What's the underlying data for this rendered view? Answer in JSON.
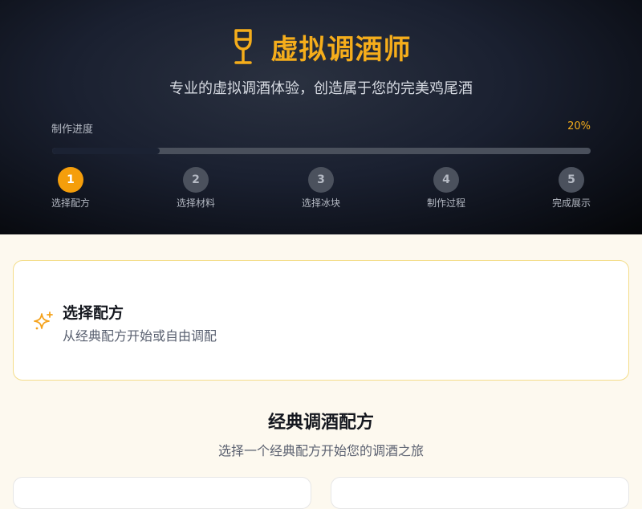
{
  "header": {
    "title": "虚拟调酒师",
    "subtitle": "专业的虚拟调酒体验，创造属于您的完美鸡尾酒",
    "icon": "wine-glass-icon"
  },
  "progress": {
    "label": "制作进度",
    "percent_text": "20%",
    "value": 0.2
  },
  "steps": [
    {
      "number": "1",
      "label": "选择配方",
      "active": true
    },
    {
      "number": "2",
      "label": "选择材料",
      "active": false
    },
    {
      "number": "3",
      "label": "选择冰块",
      "active": false
    },
    {
      "number": "4",
      "label": "制作过程",
      "active": false
    },
    {
      "number": "5",
      "label": "完成展示",
      "active": false
    }
  ],
  "step_card": {
    "icon": "sparkles-icon",
    "title": "选择配方",
    "description": "从经典配方开始或自由调配"
  },
  "section": {
    "title": "经典调酒配方",
    "subtitle": "选择一个经典配方开始您的调酒之旅"
  },
  "colors": {
    "accent": "#f59e0b",
    "header_bg": "#0c0f17",
    "page_bg": "#fdf9ef"
  }
}
